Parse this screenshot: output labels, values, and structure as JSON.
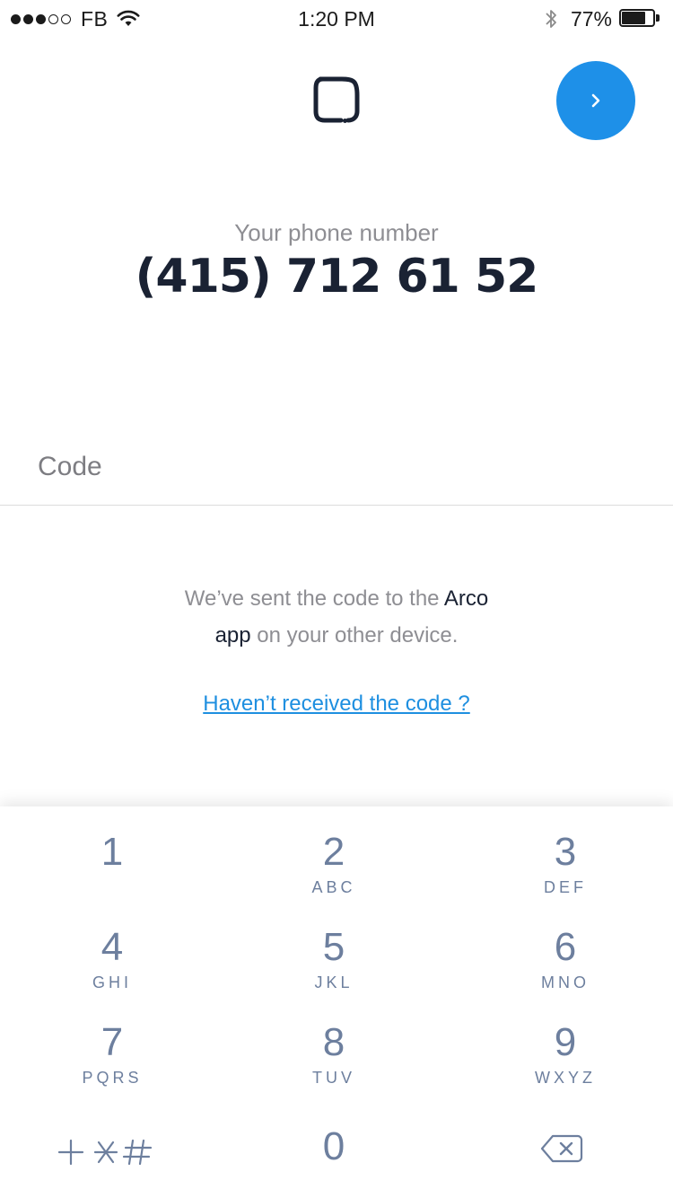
{
  "status_bar": {
    "carrier": "FB",
    "time": "1:20 PM",
    "battery_percent": "77%",
    "battery_level": 0.77
  },
  "header": {
    "logo_icon": "arco-logo-icon",
    "next_icon": "chevron-right-icon",
    "accent_color": "#1e90e8"
  },
  "phone": {
    "label": "Your phone number",
    "number": "(415) 712 61 52"
  },
  "code_field": {
    "placeholder": "Code",
    "value": ""
  },
  "message": {
    "part1": "We’ve sent the code to the ",
    "app_name_a": "Arco",
    "app_name_b": "app",
    "part2": " on your other device."
  },
  "resend_link": "Haven’t received the code ?",
  "keypad": {
    "keys": [
      {
        "digit": "1",
        "letters": ""
      },
      {
        "digit": "2",
        "letters": "ABC"
      },
      {
        "digit": "3",
        "letters": "DEF"
      },
      {
        "digit": "4",
        "letters": "GHI"
      },
      {
        "digit": "5",
        "letters": "JKL"
      },
      {
        "digit": "6",
        "letters": "MNO"
      },
      {
        "digit": "7",
        "letters": "PQRS"
      },
      {
        "digit": "8",
        "letters": "TUV"
      },
      {
        "digit": "9",
        "letters": "WXYZ"
      }
    ],
    "zero": "0",
    "symbols_icon": "plus-star-hash-icon",
    "delete_icon": "backspace-icon"
  }
}
